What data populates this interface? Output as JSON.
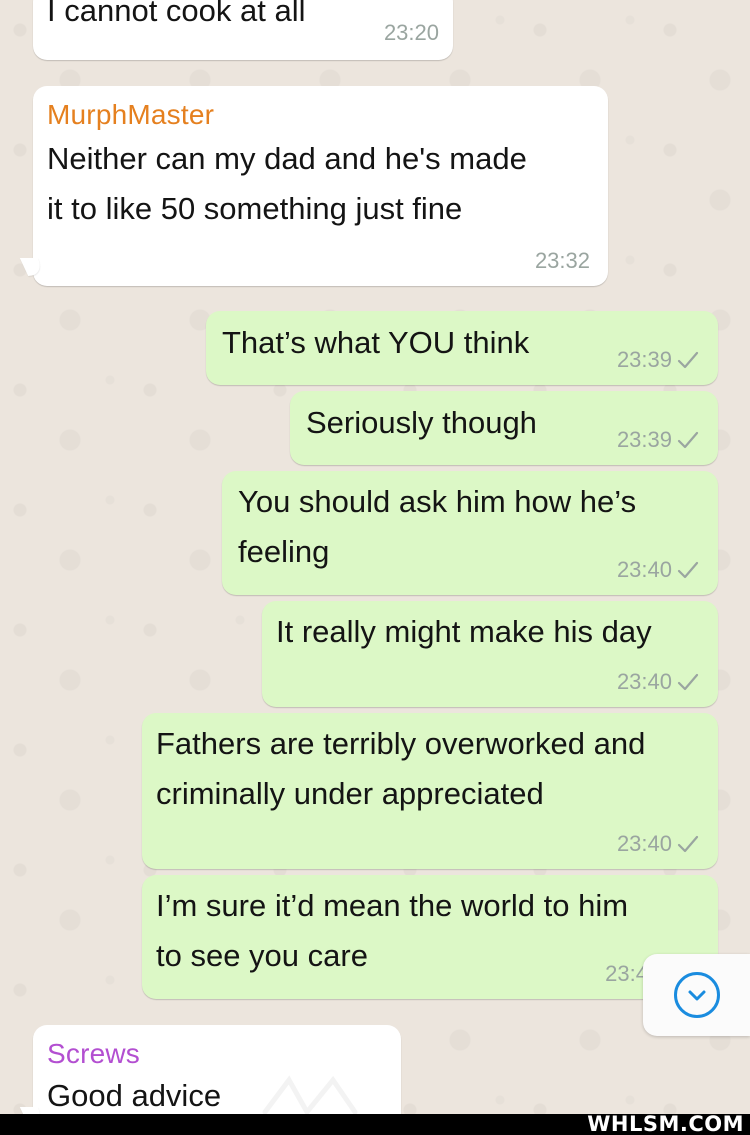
{
  "chat": {
    "messages": [
      {
        "direction": "in",
        "sender": "",
        "text_lines": [
          "I cannot cook at all"
        ],
        "time": "23:20"
      },
      {
        "direction": "in",
        "sender": "MurphMaster",
        "sender_color": "#e5801f",
        "text_lines": [
          "Neither can my dad and he's made",
          "it to like 50 something just fine"
        ],
        "time": "23:32"
      },
      {
        "direction": "out",
        "text_lines": [
          "That’s what YOU think"
        ],
        "time": "23:39",
        "status": "sent"
      },
      {
        "direction": "out",
        "text_lines": [
          "Seriously though"
        ],
        "time": "23:39",
        "status": "sent"
      },
      {
        "direction": "out",
        "text_lines": [
          "You should ask him how he’s",
          "feeling"
        ],
        "time": "23:40",
        "status": "sent"
      },
      {
        "direction": "out",
        "text_lines": [
          "It really might make his day"
        ],
        "time": "23:40",
        "status": "sent"
      },
      {
        "direction": "out",
        "text_lines": [
          "Fathers are terribly overworked and",
          "criminally under appreciated"
        ],
        "time": "23:40",
        "status": "sent"
      },
      {
        "direction": "out",
        "text_lines": [
          "I’m sure it’d mean the world to him",
          "to see you care"
        ],
        "time": "23:4",
        "status": "sent"
      },
      {
        "direction": "in",
        "sender": "Screws",
        "sender_color": "#b34fd1",
        "text_lines": [
          "Good advice"
        ],
        "time": ""
      }
    ]
  },
  "scroll_down_button": {
    "icon": "chevron-down-icon",
    "color": "#1a8cdf"
  },
  "watermark": {
    "text": "WHLSM.COM"
  },
  "colors": {
    "incoming_bubble": "#ffffff",
    "outgoing_bubble": "#dcf8c6",
    "background": "#ece5dd"
  }
}
